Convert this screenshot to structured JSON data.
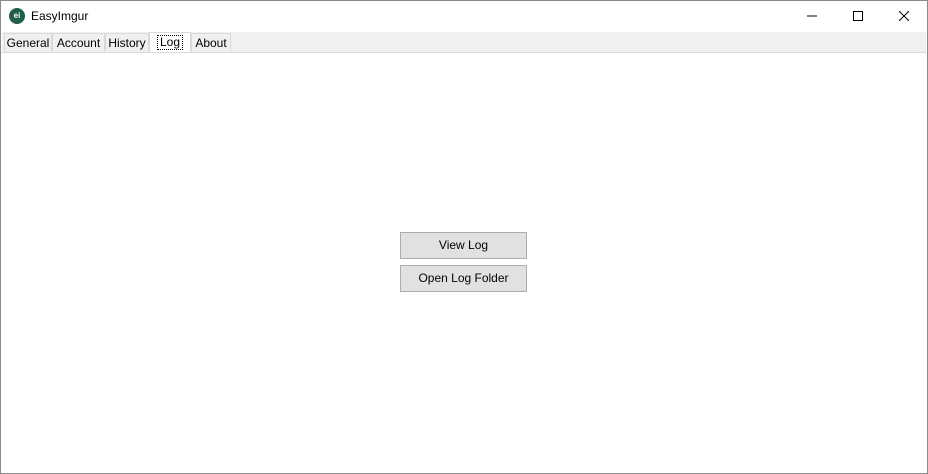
{
  "window": {
    "title": "EasyImgur",
    "icon_glyph": "ei",
    "icon_color": "#1f5f47"
  },
  "caption_buttons": {
    "minimize_icon": "minimize-icon",
    "maximize_icon": "maximize-icon",
    "close_icon": "close-icon"
  },
  "tabs": [
    {
      "label": "General",
      "selected": false
    },
    {
      "label": "Account",
      "selected": false
    },
    {
      "label": "History",
      "selected": false
    },
    {
      "label": "Log",
      "selected": true
    },
    {
      "label": "About",
      "selected": false
    }
  ],
  "log_panel": {
    "view_log_label": "View Log",
    "open_log_folder_label": "Open Log Folder"
  }
}
